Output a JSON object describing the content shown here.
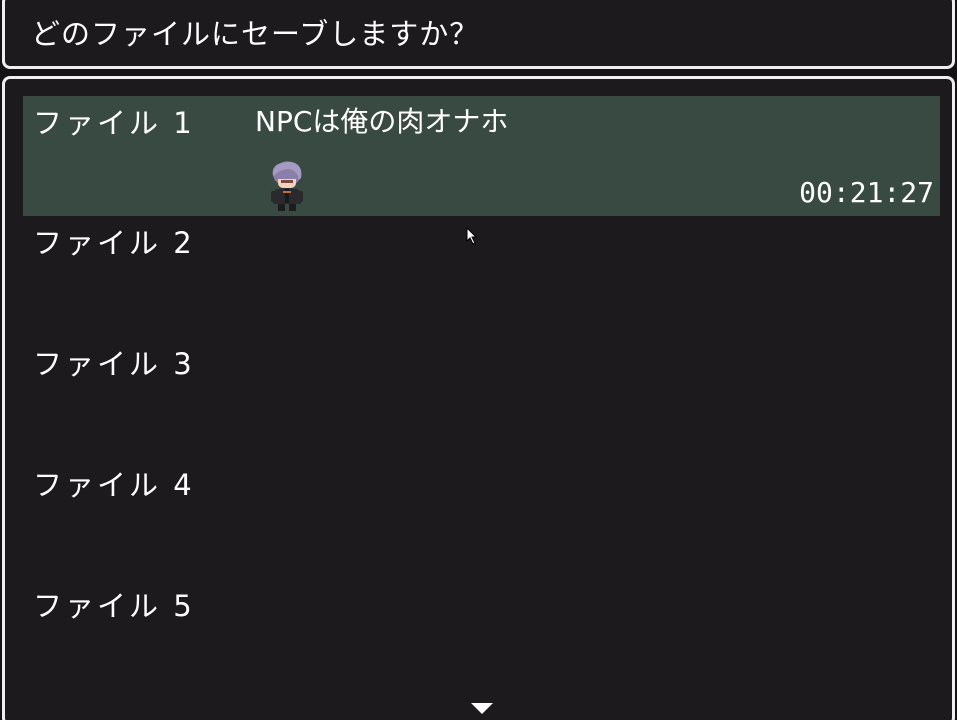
{
  "help": {
    "text": "どのファイルにセーブしますか？"
  },
  "slots": [
    {
      "label": "ファイル 1",
      "title": "NPCは俺の肉オナホ",
      "playtime": "00:21:27",
      "selected": true
    },
    {
      "label": "ファイル 2",
      "title": "",
      "playtime": "",
      "selected": false
    },
    {
      "label": "ファイル 3",
      "title": "",
      "playtime": "",
      "selected": false
    },
    {
      "label": "ファイル 4",
      "title": "",
      "playtime": "",
      "selected": false
    },
    {
      "label": "ファイル 5",
      "title": "",
      "playtime": "",
      "selected": false
    }
  ],
  "icons": {
    "scroll": "down-arrow-icon",
    "cursor": "mouse-pointer-icon",
    "character": "character-sprite"
  },
  "colors": {
    "window_border": "#efefef",
    "window_bg": "#1c1a1d",
    "selection_bg": "#384a42",
    "text": "#ffffff"
  }
}
